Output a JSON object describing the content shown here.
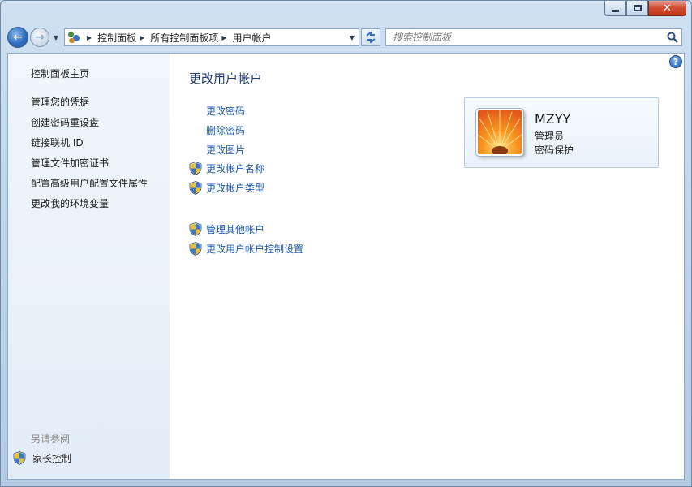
{
  "window": {
    "controls": {
      "minimize": "minimize",
      "maximize": "maximize",
      "close": "close"
    }
  },
  "nav": {
    "back_icon": "back-arrow-icon",
    "forward_icon": "forward-arrow-icon",
    "breadcrumbs": [
      "控制面板",
      "所有控制面板项",
      "用户帐户"
    ],
    "search_placeholder": "搜索控制面板"
  },
  "sidebar": {
    "home": "控制面板主页",
    "items": [
      "管理您的凭据",
      "创建密码重设盘",
      "链接联机 ID",
      "管理文件加密证书",
      "配置高级用户配置文件属性",
      "更改我的环境变量"
    ],
    "see_also_label": "另请参阅",
    "see_also_items": [
      "家长控制"
    ]
  },
  "main": {
    "title": "更改用户帐户",
    "tasks": [
      {
        "label": "更改密码",
        "shield": false
      },
      {
        "label": "删除密码",
        "shield": false
      },
      {
        "label": "更改图片",
        "shield": false
      },
      {
        "label": "更改帐户名称",
        "shield": true
      },
      {
        "label": "更改帐户类型",
        "shield": true
      }
    ],
    "tasks2": [
      {
        "label": "管理其他帐户",
        "shield": true
      },
      {
        "label": "更改用户帐户控制设置",
        "shield": true
      }
    ]
  },
  "user": {
    "name": "MZYY",
    "role": "管理员",
    "password_status": "密码保护"
  },
  "colors": {
    "link": "#1e5aa8",
    "title": "#1e3a6e",
    "sidebar_bg": "#e8f0f9"
  }
}
